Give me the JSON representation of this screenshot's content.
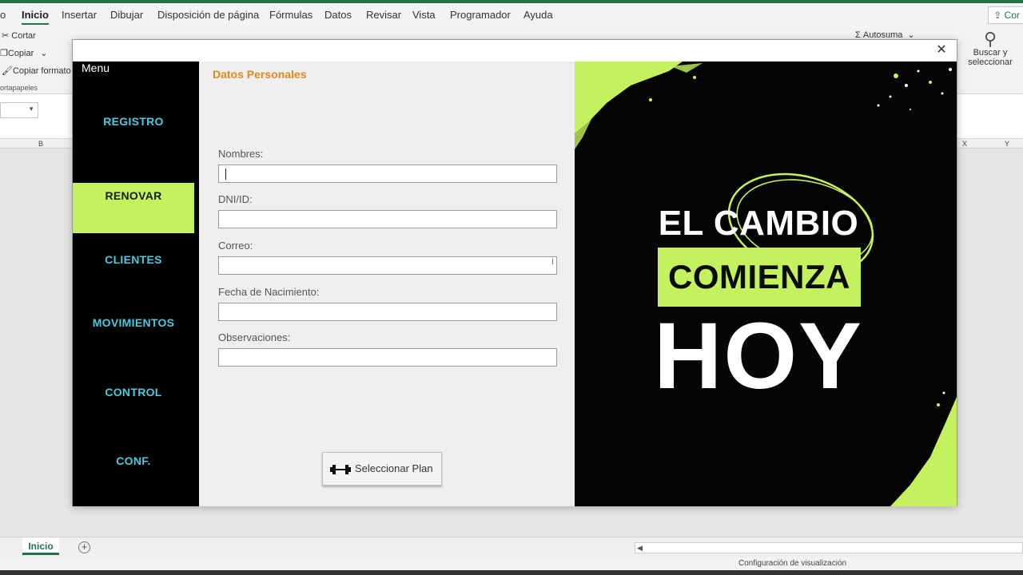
{
  "excel": {
    "menu": [
      "o",
      "Inicio",
      "Insertar",
      "Dibujar",
      "Disposición de página",
      "Fórmulas",
      "Datos",
      "Revisar",
      "Vista",
      "Programador",
      "Ayuda"
    ],
    "share_label": "Cor",
    "ribbon": {
      "cut": "Cortar",
      "copy": "Copiar",
      "copy_format": "Copiar formato",
      "clipboard_group": "ortapapeles",
      "autosum": "Autosuma",
      "find_line1": "Buscar y",
      "find_line2": "seleccionar"
    },
    "columns": {
      "b": "B",
      "x": "X",
      "y": "Y"
    },
    "sheet_tab": "Inicio",
    "status": "Configuración de visualización"
  },
  "modal": {
    "close_symbol": "✕",
    "sidebar": {
      "title": "Menu",
      "items": [
        {
          "label": "REGISTRO",
          "active": false
        },
        {
          "label": "RENOVAR",
          "active": true
        },
        {
          "label": "CLIENTES",
          "active": false
        },
        {
          "label": "MOVIMIENTOS",
          "active": false
        },
        {
          "label": "CONTROL",
          "active": false
        },
        {
          "label": "CONF.",
          "active": false
        }
      ]
    },
    "form": {
      "heading": "Datos Personales",
      "fields": [
        {
          "label": "Nombres:",
          "value": ""
        },
        {
          "label": "DNI/ID:",
          "value": ""
        },
        {
          "label": "Correo:",
          "value": ""
        },
        {
          "label": "Fecha de Nacimiento:",
          "value": ""
        },
        {
          "label": "Observaciones:",
          "value": ""
        }
      ],
      "plan_button": "Seleccionar Plan"
    },
    "promo": {
      "line1": "EL CAMBIO",
      "line2": "COMIENZA",
      "line3": "HOY"
    }
  },
  "colors": {
    "accent_green": "#c4f25e",
    "nav_text": "#4ec9e0",
    "heading_orange": "#e08a1e",
    "excel_green": "#217346"
  }
}
